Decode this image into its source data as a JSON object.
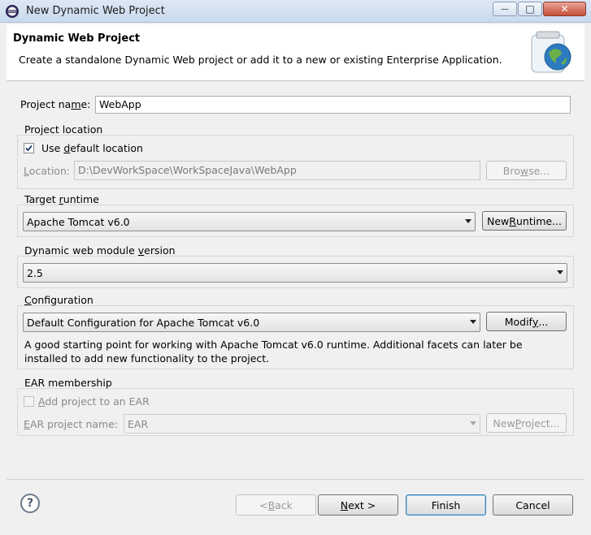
{
  "window": {
    "title": "New Dynamic Web Project",
    "min_glyph": "—",
    "max_glyph": "□",
    "close_glyph": "✕"
  },
  "banner": {
    "title": "Dynamic Web Project",
    "description": "Create a standalone Dynamic Web project or add it to a new or existing Enterprise Application."
  },
  "project_name": {
    "label_pre": "Project na",
    "label_mnemonic": "m",
    "label_post": "e:",
    "value": "WebApp"
  },
  "project_location": {
    "group_label": "Project location",
    "use_default_pre": "Use ",
    "use_default_mnemonic": "d",
    "use_default_post": "efault location",
    "use_default_checked": true,
    "location_mnemonic": "L",
    "location_post": "ocation:",
    "location_value": "D:\\DevWorkSpace\\WorkSpaceJava\\WebApp",
    "browse_pre": "Bro",
    "browse_mnemonic": "w",
    "browse_post": "se..."
  },
  "target_runtime": {
    "group_label_pre": "Target ",
    "group_label_mnemonic": "r",
    "group_label_post": "untime",
    "selected": "Apache Tomcat v6.0",
    "new_runtime_pre": "New ",
    "new_runtime_mnemonic": "R",
    "new_runtime_post": "untime..."
  },
  "module_version": {
    "group_label_pre": "Dynamic web module ",
    "group_label_mnemonic": "v",
    "group_label_post": "ersion",
    "selected": "2.5"
  },
  "configuration": {
    "group_label_mnemonic": "C",
    "group_label_post": "onfiguration",
    "selected": "Default Configuration for Apache Tomcat v6.0",
    "modify_pre": "Modif",
    "modify_mnemonic": "y",
    "modify_post": "...",
    "description_line1": "A good starting point for working with Apache Tomcat v6.0 runtime. Additional facets can later be",
    "description_line2": "installed to add new functionality to the project."
  },
  "ear": {
    "group_label": "EAR membership",
    "add_to_ear_mnemonic": "A",
    "add_to_ear_post": "dd project to an EAR",
    "add_to_ear_checked": false,
    "ear_name_mnemonic": "E",
    "ear_name_post": "AR project name:",
    "ear_name_value": "EAR",
    "new_project_pre": "New ",
    "new_project_mnemonic": "P",
    "new_project_post": "roject..."
  },
  "footer": {
    "help_glyph": "?",
    "back_pre": "< ",
    "back_mnemonic": "B",
    "back_post": "ack",
    "next_mnemonic": "N",
    "next_post": "ext >",
    "finish_label": "Finish",
    "cancel_label": "Cancel"
  },
  "icons": {
    "title": "eclipse-icon",
    "banner": "web-project-jar-globe-icon",
    "help": "help-icon"
  }
}
